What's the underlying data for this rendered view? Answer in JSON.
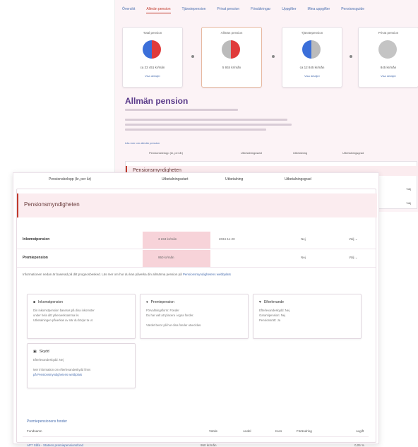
{
  "nav": {
    "tabs": [
      "Översikt",
      "Allmän pension",
      "Tjänstepension",
      "Privat pension",
      "Försäkringar",
      "Uppgifter",
      "Mina uppgifter",
      "Pensionsguide"
    ],
    "active_index": 1
  },
  "cards": [
    {
      "title": "Total pension",
      "line1": "ca 23 451 kr/mån",
      "line2": "Visa detaljer",
      "colors": [
        "#3b6fd9",
        "#e03b3b"
      ],
      "fraction": 0.5
    },
    {
      "title": "Allmän pension",
      "line1": "5 934 kr/mån",
      "line2": "",
      "colors": [
        "#bbbbbb",
        "#e03b3b"
      ],
      "fraction": 0.5
    },
    {
      "title": "Tjänstepension",
      "line1": "ca 12 845 kr/mån",
      "line2": "Visa detaljer",
      "colors": [
        "#3b6fd9",
        "#bbbbbb"
      ],
      "fraction": 0.5
    },
    {
      "title": "Privat pension",
      "line1": "845 kr/mån",
      "line2": "Visa detaljer",
      "colors": [
        "#bbbbbb",
        "#bbbbbb"
      ],
      "fraction": 0.5
    }
  ],
  "back": {
    "title": "Allmän pension",
    "link": "Läs mer om allmän pension",
    "table_headers": [
      "Pensionsbelopp (kr, per år)",
      "Utbetalningsstart",
      "Utbetalning",
      "Utbetalningsgrad"
    ],
    "section_title": "Pensionsmyndigheten",
    "row_selects": [
      "Välj",
      "Välj"
    ]
  },
  "front": {
    "headers": [
      "Pensionsbelopp (kr, per år)",
      "Utbetalningsstart",
      "Utbetalning",
      "Utbetalningsgrad"
    ],
    "section_title": "Pensionsmyndigheten",
    "rows": [
      {
        "name": "Inkomstpension",
        "value": "3 234 kr/mån",
        "date": "2034-11-20",
        "paid": "Nej",
        "select": "Välj"
      },
      {
        "name": "Premiepension",
        "value": "950 kr/mån",
        "date": "",
        "paid": "Nej",
        "select": "Välj"
      }
    ],
    "note": "Informationen nedan är baserad på ditt prognosbesked. Läs mer om hur du kan påverka din allmänna pension på",
    "note_link": "Pensionsmyndighetens webbplats",
    "boxes": [
      {
        "icon": "■",
        "title": "Inkomstpension",
        "lines": [
          "Din inkomstpension baseras på dina inkomster",
          "under hela ditt yrkesverksamma liv.",
          "Utbetalningen påverkas av när du börjar ta ut."
        ]
      },
      {
        "icon": "♦",
        "title": "Premiepension",
        "lines": [
          "Förvaltningsform: Fonder",
          "Du har valt att placera i egna fonder.",
          "",
          "Värdet beror på hur dina fonder utvecklas."
        ]
      },
      {
        "icon": "♥",
        "title": "Efterlevande",
        "lines": [
          "Efterlevandeskydd: Nej",
          "Garantipension: Nej",
          "Pensionsrätt: Ja"
        ]
      },
      {
        "icon": "▣",
        "title": "Skydd",
        "lines": [
          "Efterlevandeskydd: Nej",
          "",
          "Mer information om efterlevandeskydd finns",
          "på Pensionsmyndighetens webbplats"
        ]
      }
    ],
    "fund_section": "Premiepensionens fonder",
    "fund_headers": [
      "Fondnamn",
      "Värde",
      "Andel",
      "Kurs",
      "Förändring",
      "Avgift"
    ],
    "fund_rows": [
      {
        "name": "AP7 Såfa - Statens premiepensionsfond",
        "value": "950 kr/mån",
        "share": "",
        "price": "",
        "change": "",
        "fee": "0,05 %"
      }
    ]
  }
}
